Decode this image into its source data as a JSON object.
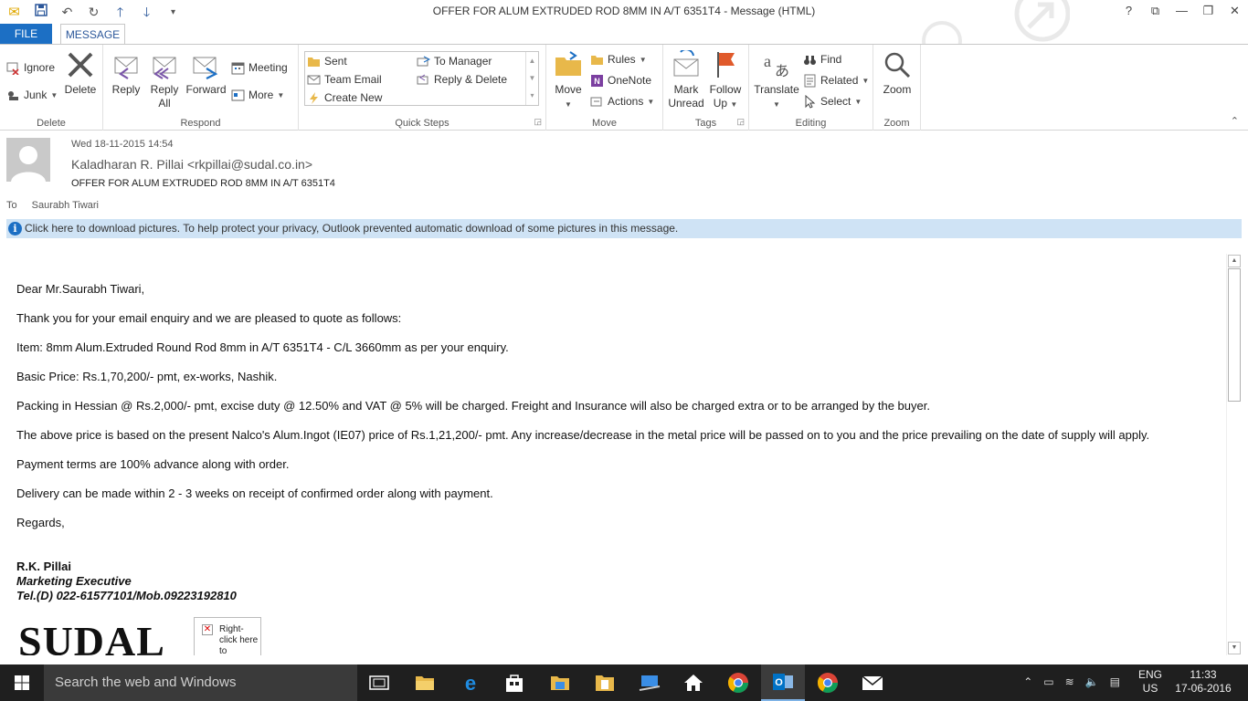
{
  "window": {
    "title": "OFFER FOR ALUM EXTRUDED ROD 8MM IN A/T 6351T4 - Message (HTML)",
    "controls": [
      "?",
      "⧉",
      "—",
      "❐",
      "✕"
    ]
  },
  "tabs": {
    "file": "FILE",
    "message": "MESSAGE"
  },
  "ribbon": {
    "delete_group": {
      "label": "Delete",
      "ignore": "Ignore",
      "junk": "Junk",
      "delete": "Delete"
    },
    "respond_group": {
      "label": "Respond",
      "reply": "Reply",
      "reply_all_1": "Reply",
      "reply_all_2": "All",
      "forward": "Forward",
      "meeting": "Meeting",
      "more": "More"
    },
    "quicksteps_group": {
      "label": "Quick Steps",
      "sent": "Sent",
      "team_email": "Team Email",
      "create_new": "Create New",
      "to_manager": "To Manager",
      "reply_delete": "Reply & Delete"
    },
    "move_group": {
      "label": "Move",
      "move": "Move",
      "rules": "Rules",
      "onenote": "OneNote",
      "actions": "Actions"
    },
    "tags_group": {
      "label": "Tags",
      "mark_unread_1": "Mark",
      "mark_unread_2": "Unread",
      "follow_up_1": "Follow",
      "follow_up_2": "Up"
    },
    "editing_group": {
      "label": "Editing",
      "translate": "Translate",
      "find": "Find",
      "related": "Related",
      "select": "Select"
    },
    "zoom_group": {
      "label": "Zoom",
      "zoom": "Zoom"
    }
  },
  "header": {
    "date": "Wed 18-11-2015 14:54",
    "from": "Kaladharan R. Pillai <rkpillai@sudal.co.in>",
    "subject": "OFFER FOR ALUM EXTRUDED ROD 8MM IN A/T 6351T4",
    "to_label": "To",
    "to_name": "Saurabh Tiwari",
    "infobar": "Click here to download pictures. To help protect your privacy, Outlook prevented automatic download of some pictures in this message."
  },
  "body": {
    "greeting": "Dear Mr.Saurabh Tiwari,",
    "line1": "Thank you for your email enquiry and we are pleased to quote as follows:",
    "line2": "Item: 8mm Alum.Extruded Round Rod 8mm in A/T 6351T4 - C/L 3660mm as per your enquiry.",
    "line3": "Basic Price: Rs.1,70,200/- pmt, ex-works, Nashik.",
    "line4": "Packing in Hessian @ Rs.2,000/- pmt, excise duty @ 12.50% and VAT @ 5% will be charged.  Freight and Insurance will also be charged extra or to be arranged by the buyer.",
    "line5": "The above price is based on the present Nalco's Alum.Ingot (IE07) price of Rs.1,21,200/- pmt.  Any increase/decrease in the metal price will be passed on to you and the price prevailing on the date of supply will apply.",
    "line6": "Payment terms are 100% advance along with order.",
    "line7": "Delivery can be made within 2 - 3 weeks on receipt of confirmed order along with payment.",
    "regards": "Regards,",
    "sig_name": "R.K. Pillai",
    "sig_title": "Marketing Executive",
    "sig_tel": "Tel.(D) 022-61577101/Mob.09223192810",
    "logo_text": "SUDAL",
    "broken_image_text": "Right-click here to"
  },
  "taskbar": {
    "search_placeholder": "Search the web and Windows",
    "lang_1": "ENG",
    "lang_2": "US",
    "time": "11:33",
    "date": "17-06-2016"
  },
  "colors": {
    "accent": "#1c6fc4",
    "infobar": "#cfe3f5",
    "taskbar": "#1f1f1f"
  }
}
